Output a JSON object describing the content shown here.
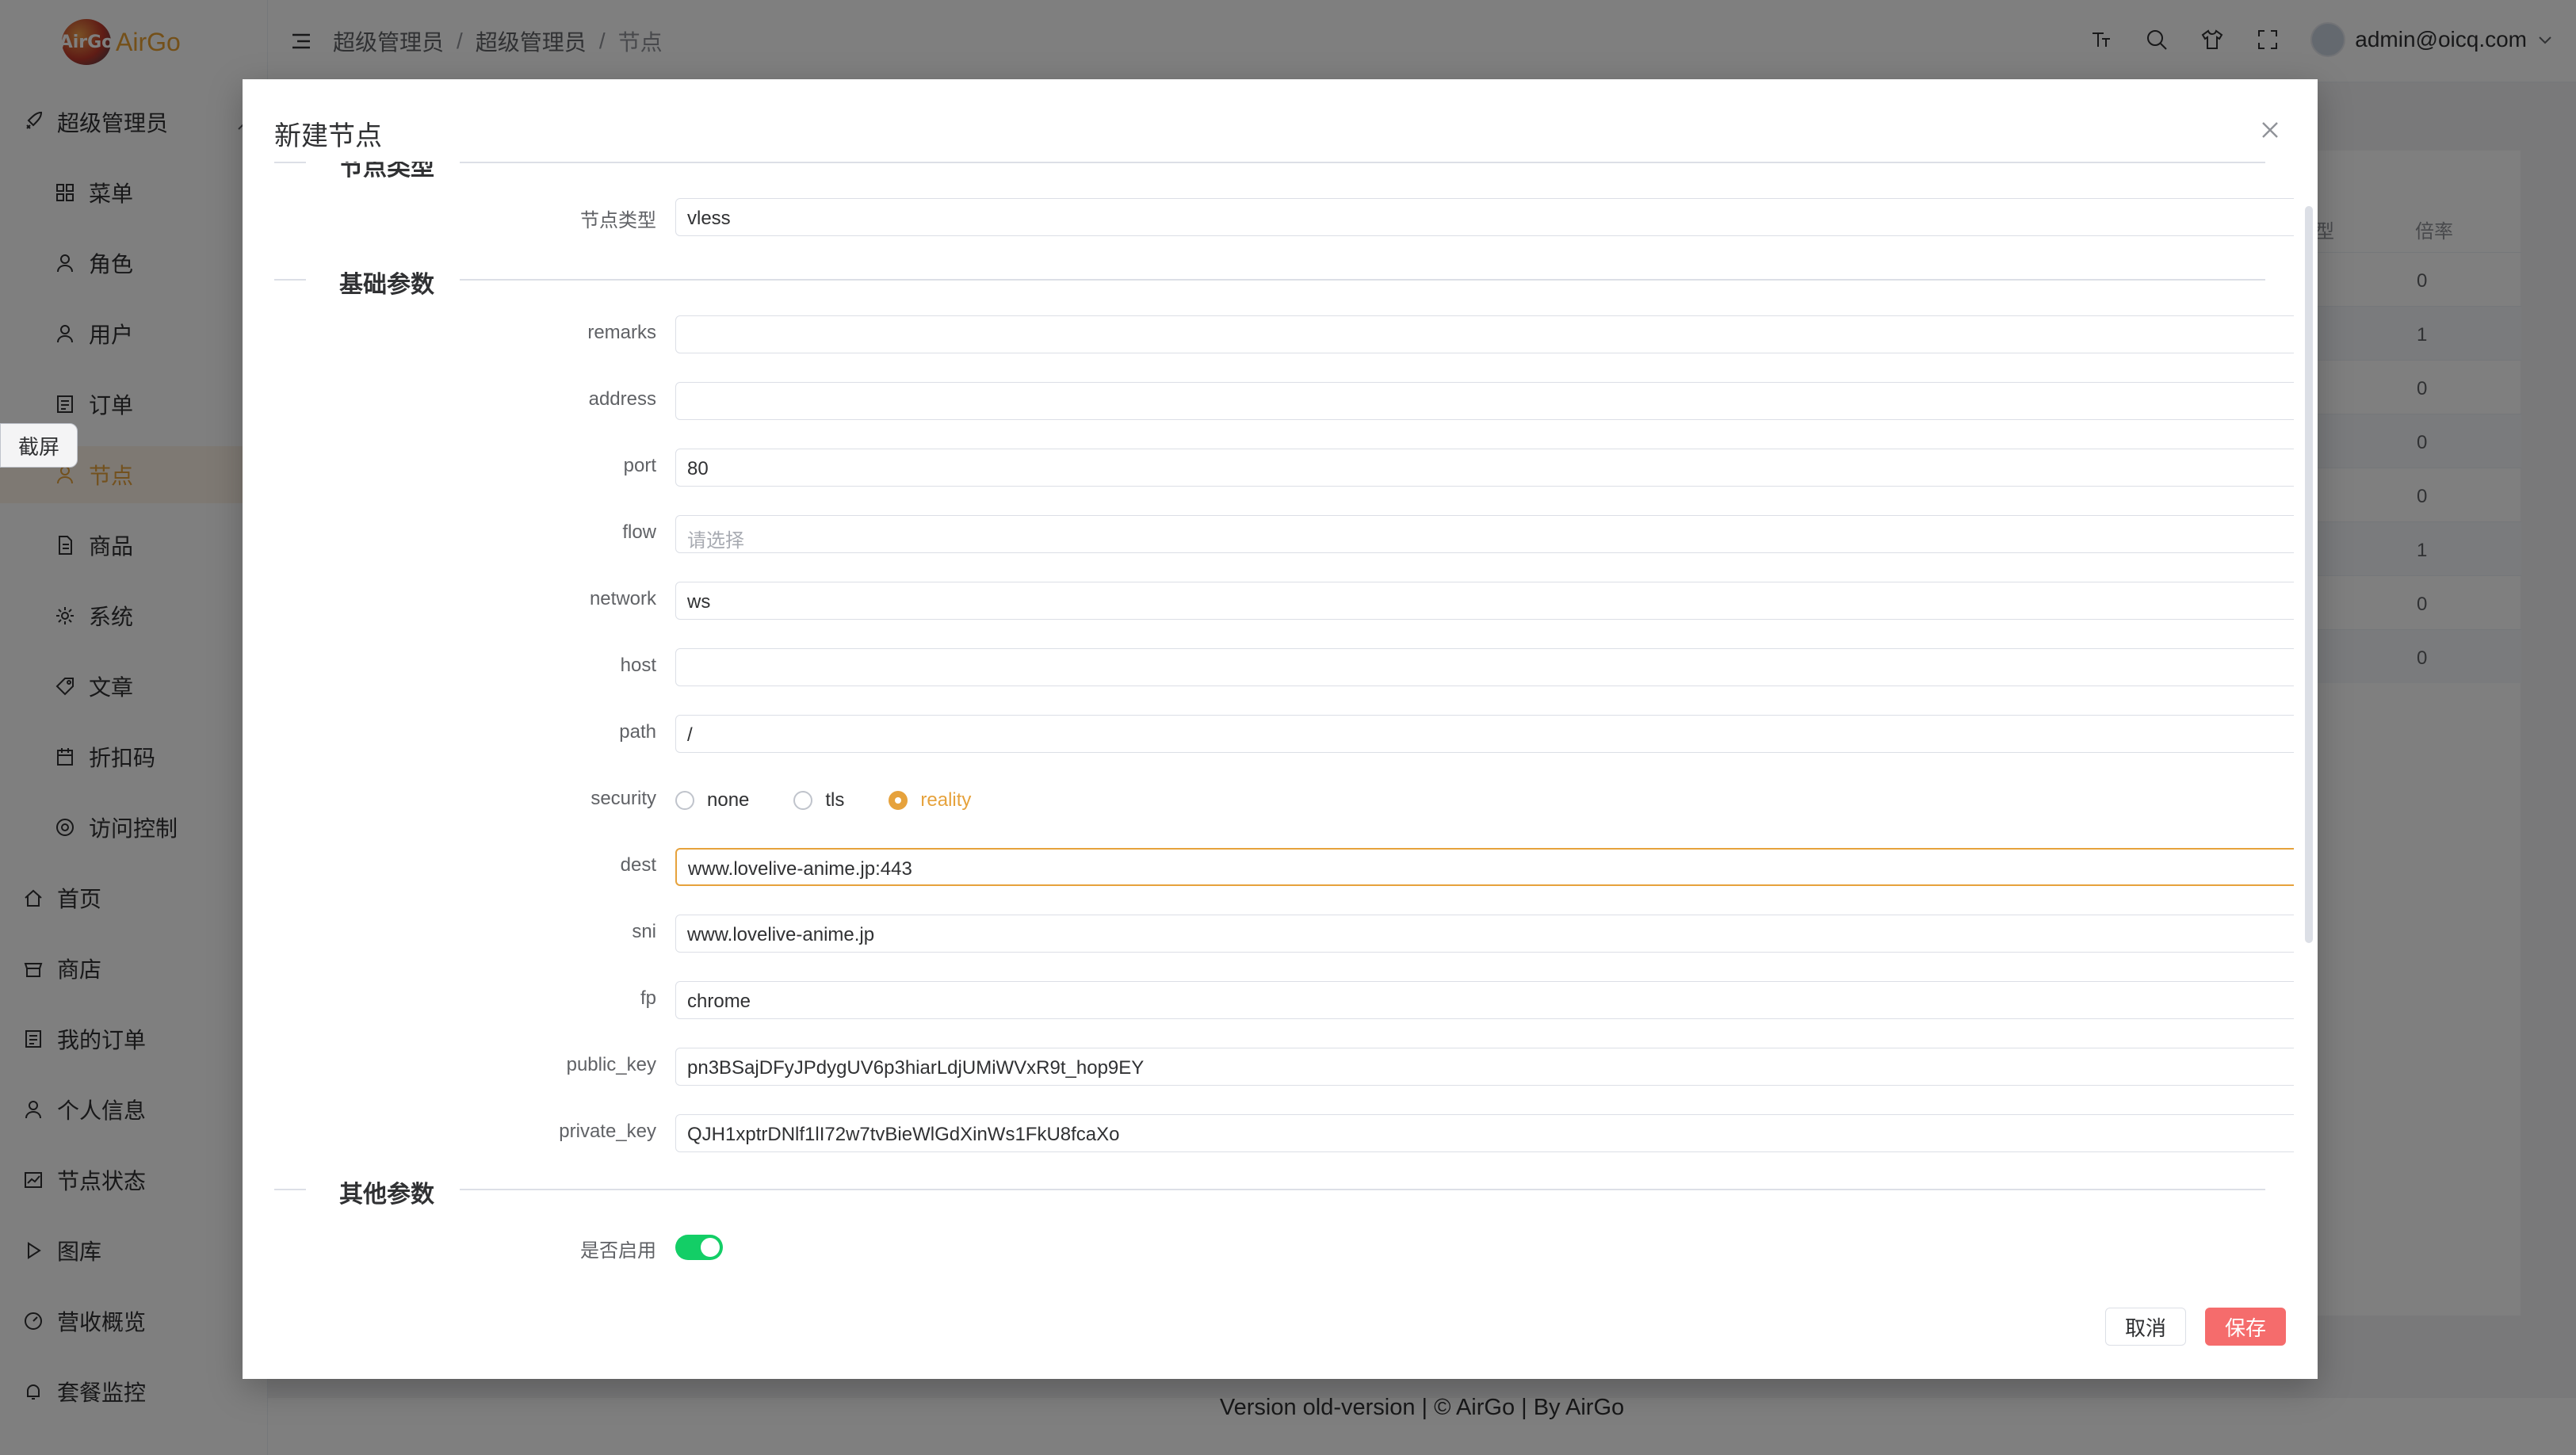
{
  "app": {
    "logo_mark": "AirGo",
    "logo_text": "AirGo"
  },
  "sidebar": {
    "items": [
      {
        "label": "超级管理员",
        "icon": "rocket-icon",
        "level": 1,
        "expanded": true
      },
      {
        "label": "菜单",
        "icon": "grid-icon",
        "level": 2
      },
      {
        "label": "角色",
        "icon": "user-icon",
        "level": 2
      },
      {
        "label": "用户",
        "icon": "user-icon",
        "level": 2
      },
      {
        "label": "订单",
        "icon": "list-icon",
        "level": 2
      },
      {
        "label": "节点",
        "icon": "user-icon",
        "level": 2,
        "active": true
      },
      {
        "label": "商品",
        "icon": "document-icon",
        "level": 2
      },
      {
        "label": "系统",
        "icon": "gear-icon",
        "level": 2
      },
      {
        "label": "文章",
        "icon": "tag-icon",
        "level": 2
      },
      {
        "label": "折扣码",
        "icon": "calendar-icon",
        "level": 2
      },
      {
        "label": "访问控制",
        "icon": "chrome-icon",
        "level": 2
      },
      {
        "label": "首页",
        "icon": "home-icon",
        "level": 1
      },
      {
        "label": "商店",
        "icon": "shop-icon",
        "level": 1
      },
      {
        "label": "我的订单",
        "icon": "list-icon",
        "level": 1
      },
      {
        "label": "个人信息",
        "icon": "user-icon",
        "level": 1
      },
      {
        "label": "节点状态",
        "icon": "chart-icon",
        "level": 1
      },
      {
        "label": "图库",
        "icon": "play-icon",
        "level": 1
      },
      {
        "label": "营收概览",
        "icon": "gauge-icon",
        "level": 1
      },
      {
        "label": "套餐监控",
        "icon": "bell-icon",
        "level": 1
      }
    ]
  },
  "header": {
    "breadcrumb": [
      "超级管理员",
      "超级管理员",
      "节点"
    ],
    "user_email": "admin@oicq.com"
  },
  "screenshot_tip": "截屏",
  "background_table": {
    "header_left": "型",
    "header_right": "倍率",
    "rows": [
      "0",
      "1",
      "0",
      "0",
      "0",
      "1",
      "0",
      "0"
    ]
  },
  "footer": {
    "text": "Version old-version | © AirGo | By AirGo"
  },
  "dialog": {
    "title": "新建节点",
    "sections": {
      "node_type": "节点类型",
      "basic": "基础参数",
      "other": "其他参数"
    },
    "fields": {
      "node_type": {
        "label": "节点类型",
        "value": "vless"
      },
      "remarks": {
        "label": "remarks",
        "value": ""
      },
      "address": {
        "label": "address",
        "value": ""
      },
      "port": {
        "label": "port",
        "value": "80"
      },
      "flow": {
        "label": "flow",
        "placeholder": "请选择"
      },
      "network": {
        "label": "network",
        "value": "ws"
      },
      "host": {
        "label": "host",
        "value": ""
      },
      "path": {
        "label": "path",
        "value": "/"
      },
      "security": {
        "label": "security",
        "options": [
          "none",
          "tls",
          "reality"
        ],
        "selected": "reality"
      },
      "dest": {
        "label": "dest",
        "value": "www.lovelive-anime.jp:443"
      },
      "sni": {
        "label": "sni",
        "value": "www.lovelive-anime.jp"
      },
      "fp": {
        "label": "fp",
        "value": "chrome"
      },
      "public_key": {
        "label": "public_key",
        "value": "pn3BSajDFyJPdygUV6p3hiarLdjUMiWVxR9t_hop9EY"
      },
      "private_key": {
        "label": "private_key",
        "value": "QJH1xptrDNlf1lI72w7tvBieWlGdXinWs1FkU8fcaXo"
      },
      "enabled": {
        "label": "是否启用",
        "value": true
      }
    },
    "buttons": {
      "cancel": "取消",
      "save": "保存"
    }
  },
  "colors": {
    "accent": "#e6a23c",
    "danger": "#f56c6c",
    "switch_on": "#13ce66"
  }
}
